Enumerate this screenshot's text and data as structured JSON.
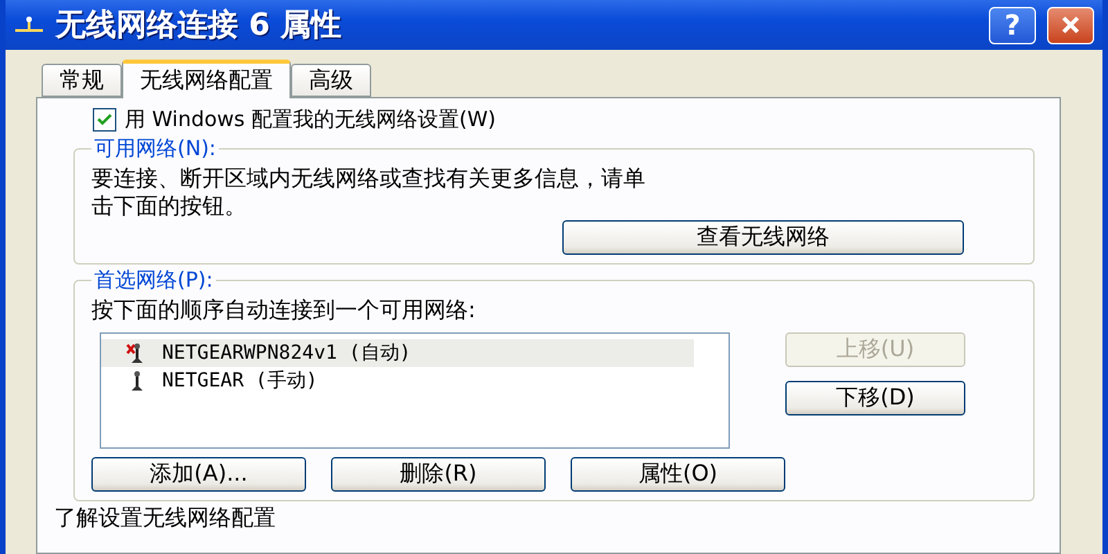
{
  "window": {
    "title": "无线网络连接 6 属性",
    "help": "?"
  },
  "tabs": [
    {
      "label": "常规",
      "selected": false
    },
    {
      "label": "无线网络配置",
      "selected": true
    },
    {
      "label": "高级",
      "selected": false
    }
  ],
  "use_windows": {
    "label": "用 Windows 配置我的无线网络设置(W)",
    "checked": true
  },
  "available": {
    "title": "可用网络(N):",
    "text": "要连接、断开区域内无线网络或查找有关更多信息，请单击下面的按钮。",
    "button": "查看无线网络"
  },
  "preferred": {
    "title": "首选网络(P):",
    "text": "按下面的顺序自动连接到一个可用网络:",
    "networks": [
      {
        "name": "NETGEARWPN824v1 (自动)",
        "selected": true,
        "kind": "unavailable"
      },
      {
        "name": "NETGEAR (手动)",
        "selected": false,
        "kind": "available"
      }
    ],
    "side_buttons": [
      {
        "label": "上移(U)",
        "disabled": true
      },
      {
        "label": "下移(D)",
        "disabled": false
      }
    ],
    "buttons": [
      {
        "label": "添加(A)..."
      },
      {
        "label": "删除(R)"
      },
      {
        "label": "属性(O)"
      }
    ]
  },
  "footer": {
    "text": "了解设置无线网络配置"
  }
}
